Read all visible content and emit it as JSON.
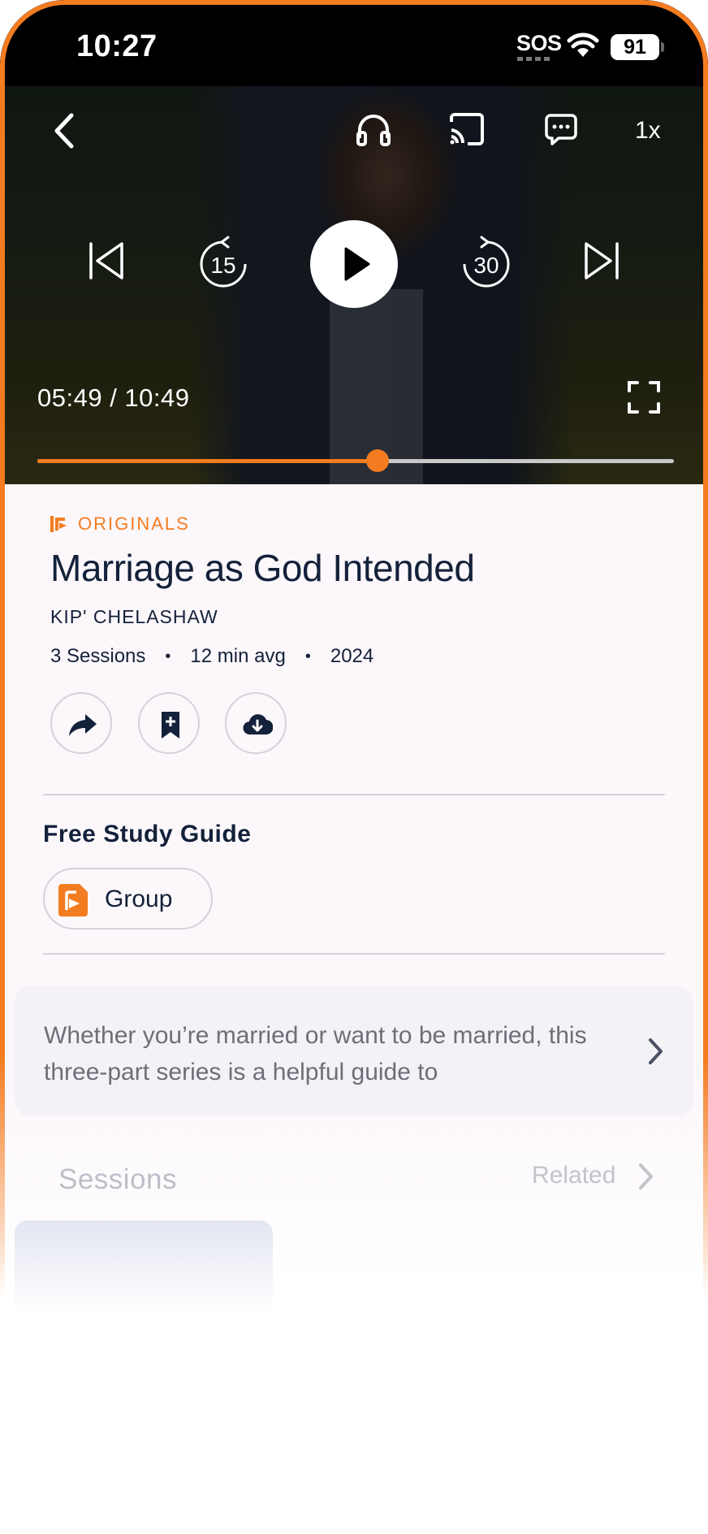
{
  "status_bar": {
    "time": "10:27",
    "sos": "SOS",
    "battery": "91"
  },
  "player": {
    "speed": "1x",
    "time_display": "05:49 / 10:49",
    "progress_fraction": 0.535,
    "accent_color": "#f47c20",
    "icons": [
      "back-chevron-icon",
      "headphones-icon",
      "cast-icon",
      "captions-icon",
      "skip-previous-icon",
      "rewind-15-icon",
      "play-icon",
      "forward-30-icon",
      "skip-next-icon",
      "fullscreen-icon"
    ],
    "rewind_seconds": "15",
    "forward_seconds": "30"
  },
  "details": {
    "category": "ORIGINALS",
    "title": "Marriage as God Intended",
    "author": "KIP' CHELASHAW",
    "meta": {
      "sessions": "3 Sessions",
      "avg": "12 min avg",
      "year": "2024"
    },
    "actions": [
      "share-icon",
      "bookmark-add-icon",
      "download-cloud-icon"
    ]
  },
  "study_guide": {
    "heading": "Free Study Guide",
    "group_label": "Group"
  },
  "description": {
    "text": "Whether you’re married or want to be married, this three-part series is a helpful guide to"
  },
  "tabs": {
    "sessions": "Sessions",
    "related": "Related"
  }
}
